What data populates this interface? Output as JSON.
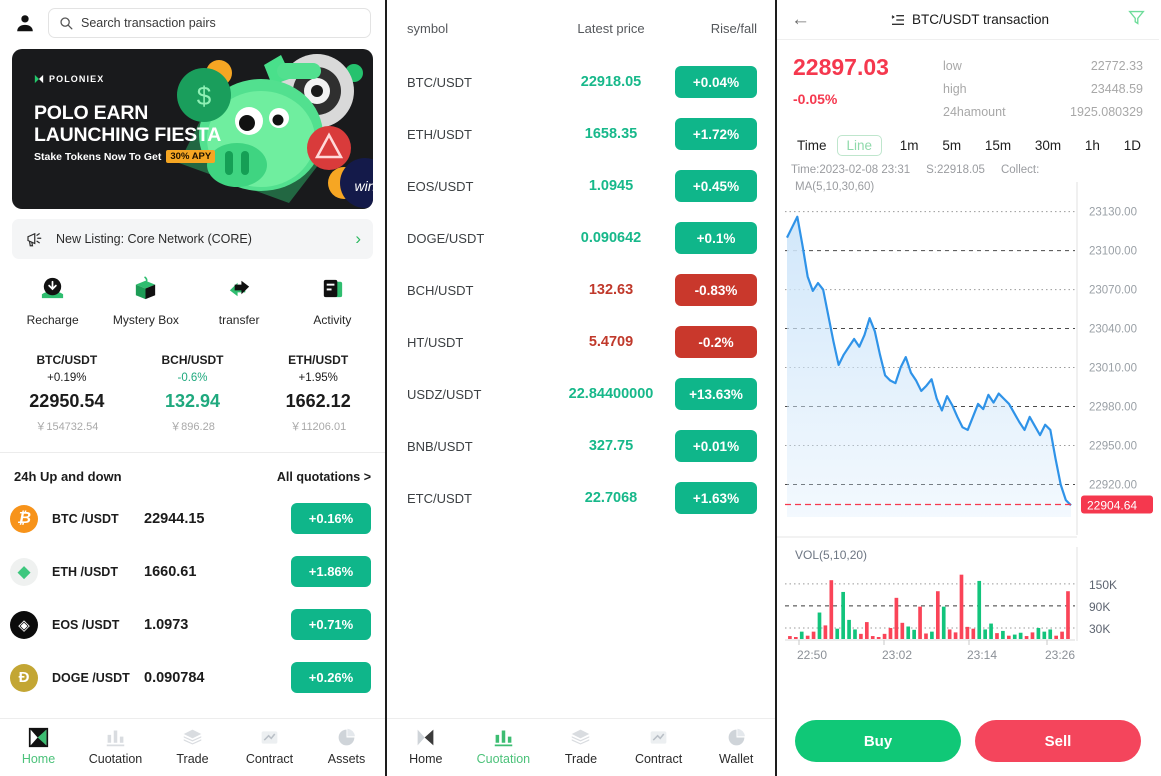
{
  "panel1": {
    "search": {
      "placeholder": "Search transaction pairs",
      "icon": "search-icon"
    },
    "avatar_icon": "user-avatar-icon",
    "banner": {
      "brand": "POLONIEX",
      "headline_line1": "POLO EARN",
      "headline_line2": "LAUNCHING FIESTA",
      "sub": "Stake Tokens Now To Get",
      "apy": "30% APY"
    },
    "new_listing": {
      "text": "New Listing: Core Network (CORE)",
      "icon": "megaphone-icon",
      "chevron": "›"
    },
    "quick_actions": [
      {
        "label": "Recharge",
        "icon": "download-circle-icon"
      },
      {
        "label": "Mystery Box",
        "icon": "gift-box-icon"
      },
      {
        "label": "transfer",
        "icon": "transfer-arrows-icon"
      },
      {
        "label": "Activity",
        "icon": "document-icon"
      }
    ],
    "tickers": [
      {
        "pair": "BTC/USDT",
        "pct": "+0.19%",
        "price": "22950.54",
        "cny": "￥154732.54",
        "price_color": "#1b1b1b",
        "pct_color": "#1b1b1b"
      },
      {
        "pair": "BCH/USDT",
        "pct": "-0.6%",
        "price": "132.94",
        "cny": "￥896.28",
        "price_color": "#1fa97e",
        "pct_color": "#1fa97e"
      },
      {
        "pair": "ETH/USDT",
        "pct": "+1.95%",
        "price": "1662.12",
        "cny": "￥11206.01",
        "price_color": "#1b1b1b",
        "pct_color": "#1b1b1b"
      }
    ],
    "updown": {
      "title": "24h Up and down",
      "all": "All quotations >"
    },
    "coins": [
      {
        "symbol": "BTC /USDT",
        "price": "22944.15",
        "change": "+0.16%",
        "dir": "up",
        "icon": "bitcoin-icon",
        "bg": "#f7931a",
        "glyph": "₿"
      },
      {
        "symbol": "ETH /USDT",
        "price": "1660.61",
        "change": "+1.86%",
        "dir": "up",
        "icon": "ethereum-icon",
        "bg": "#eff1f0",
        "glyph": "◆"
      },
      {
        "symbol": "EOS /USDT",
        "price": "1.0973",
        "change": "+0.71%",
        "dir": "up",
        "icon": "eos-icon",
        "bg": "#0b0b0b",
        "glyph": "◈"
      },
      {
        "symbol": "DOGE /USDT",
        "price": "0.090784",
        "change": "+0.26%",
        "dir": "up",
        "icon": "dogecoin-icon",
        "bg": "#c3a634",
        "glyph": "Ɖ"
      }
    ],
    "tabs": [
      {
        "label": "Home",
        "icon": "home-logo-icon",
        "active": true
      },
      {
        "label": "Cuotation",
        "icon": "bar-chart-icon",
        "active": false
      },
      {
        "label": "Trade",
        "icon": "layers-icon",
        "active": false
      },
      {
        "label": "Contract",
        "icon": "trend-image-icon",
        "active": false
      },
      {
        "label": "Assets",
        "icon": "pie-chart-icon",
        "active": false
      }
    ]
  },
  "panel2": {
    "headers": {
      "symbol": "symbol",
      "price": "Latest price",
      "change": "Rise/fall"
    },
    "rows": [
      {
        "symbol": "BTC/USDT",
        "price": "22918.05",
        "change": "+0.04%",
        "dir": "up"
      },
      {
        "symbol": "ETH/USDT",
        "price": "1658.35",
        "change": "+1.72%",
        "dir": "up"
      },
      {
        "symbol": "EOS/USDT",
        "price": "1.0945",
        "change": "+0.45%",
        "dir": "up"
      },
      {
        "symbol": "DOGE/USDT",
        "price": "0.090642",
        "change": "+0.1%",
        "dir": "up"
      },
      {
        "symbol": "BCH/USDT",
        "price": "132.63",
        "change": "-0.83%",
        "dir": "down"
      },
      {
        "symbol": "HT/USDT",
        "price": "5.4709",
        "change": "-0.2%",
        "dir": "down"
      },
      {
        "symbol": "USDZ/USDT",
        "price": "22.84400000",
        "change": "+13.63%",
        "dir": "up"
      },
      {
        "symbol": "BNB/USDT",
        "price": "327.75",
        "change": "+0.01%",
        "dir": "up"
      },
      {
        "symbol": "ETC/USDT",
        "price": "22.7068",
        "change": "+1.63%",
        "dir": "up"
      }
    ],
    "tabs": [
      {
        "label": "Home",
        "icon": "home-logo-icon",
        "active": false
      },
      {
        "label": "Cuotation",
        "icon": "bar-chart-icon",
        "active": true
      },
      {
        "label": "Trade",
        "icon": "layers-icon",
        "active": false
      },
      {
        "label": "Contract",
        "icon": "trend-image-icon",
        "active": false
      },
      {
        "label": "Wallet",
        "icon": "pie-chart-icon",
        "active": false
      }
    ]
  },
  "panel3": {
    "header": {
      "back_icon": "back-arrow-icon",
      "list_icon": "list-icon",
      "title": "BTC/USDT transaction",
      "filter_icon": "filter-funnel-icon"
    },
    "quote": {
      "last": "22897.03",
      "change": "-0.05%",
      "low_label": "low",
      "low_value": "22772.33",
      "high_label": "high",
      "high_value": "23448.59",
      "amount_label": "24hamount",
      "amount_value": "1925.080329",
      "color": "#f5384e"
    },
    "periods": [
      {
        "label": "Time",
        "selected": false
      },
      {
        "label": "Line",
        "selected": true
      },
      {
        "label": "1m",
        "selected": false
      },
      {
        "label": "5m",
        "selected": false
      },
      {
        "label": "15m",
        "selected": false
      },
      {
        "label": "30m",
        "selected": false
      },
      {
        "label": "1h",
        "selected": false
      },
      {
        "label": "1D",
        "selected": false
      }
    ],
    "chart_info": {
      "time": "Time:2023-02-08 23:31",
      "s": "S:22918.05",
      "collect": "Collect:"
    },
    "ma_label": "MA(5,10,30,60)",
    "vol_label": "VOL(5,10,20)",
    "actions": {
      "buy": "Buy",
      "sell": "Sell"
    }
  },
  "chart_data": [
    {
      "type": "area",
      "title": "BTC/USDT price line",
      "ylabel": "",
      "xlabel": "",
      "ylim": [
        22890,
        23150
      ],
      "yticks": [
        "23130.00",
        "23100.00",
        "23070.00",
        "23040.00",
        "23010.00",
        "22980.00",
        "22950.00",
        "22920.00"
      ],
      "ytick_values": [
        23130,
        23100,
        23070,
        23040,
        23010,
        22980,
        22950,
        22920
      ],
      "xticks": [
        "22:50",
        "23:02",
        "23:14",
        "23:26"
      ],
      "grid": true,
      "line_color": "#2f93e8",
      "fill_color": "#cfe6fa",
      "marker_price": "22904.64",
      "marker_color": "#f5384e",
      "values": [
        23110,
        23118,
        23126,
        23104,
        23080,
        23069,
        23075,
        23070,
        23050,
        23030,
        23012,
        23020,
        23026,
        23032,
        23026,
        23035,
        23048,
        23038,
        23020,
        23004,
        23000,
        22998,
        23010,
        23018,
        23006,
        23000,
        22992,
        22996,
        23001,
        22986,
        22977,
        22988,
        22981,
        22972,
        22964,
        22962,
        22972,
        22982,
        22978,
        22989,
        22983,
        22990,
        22986,
        22982,
        22975,
        22968,
        22962,
        22972,
        22965,
        22958,
        22966,
        22962,
        22940,
        22920,
        22908,
        22904
      ]
    },
    {
      "type": "bar",
      "title": "VOL(5,10,20)",
      "yticks": [
        "150K",
        "90K",
        "30K"
      ],
      "ytick_values": [
        150000,
        90000,
        30000
      ],
      "ylim": [
        0,
        185000
      ],
      "xticks": [
        "22:50",
        "23:02",
        "23:14",
        "23:26"
      ],
      "up_color": "#12c47c",
      "down_color": "#fa4458",
      "values": [
        8000,
        4000,
        20000,
        9000,
        20000,
        72000,
        37000,
        160000,
        28000,
        128000,
        52000,
        26000,
        14000,
        46000,
        8000,
        5000,
        14000,
        30000,
        112000,
        44000,
        34000,
        25000,
        88000,
        15000,
        20000,
        130000,
        88000,
        26000,
        18000,
        175000,
        33000,
        28000,
        158000,
        26000,
        42000,
        16000,
        22000,
        9000,
        12000,
        17000,
        8000,
        18000,
        30000,
        20000,
        26000,
        9000,
        20000,
        130000
      ],
      "directions": [
        "down",
        "down",
        "up",
        "down",
        "down",
        "up",
        "down",
        "down",
        "up",
        "up",
        "up",
        "up",
        "down",
        "down",
        "down",
        "down",
        "down",
        "down",
        "down",
        "down",
        "up",
        "up",
        "down",
        "down",
        "up",
        "down",
        "up",
        "down",
        "down",
        "down",
        "down",
        "down",
        "up",
        "up",
        "up",
        "down",
        "up",
        "down",
        "up",
        "up",
        "down",
        "down",
        "up",
        "up",
        "up",
        "down",
        "down",
        "down"
      ]
    }
  ]
}
